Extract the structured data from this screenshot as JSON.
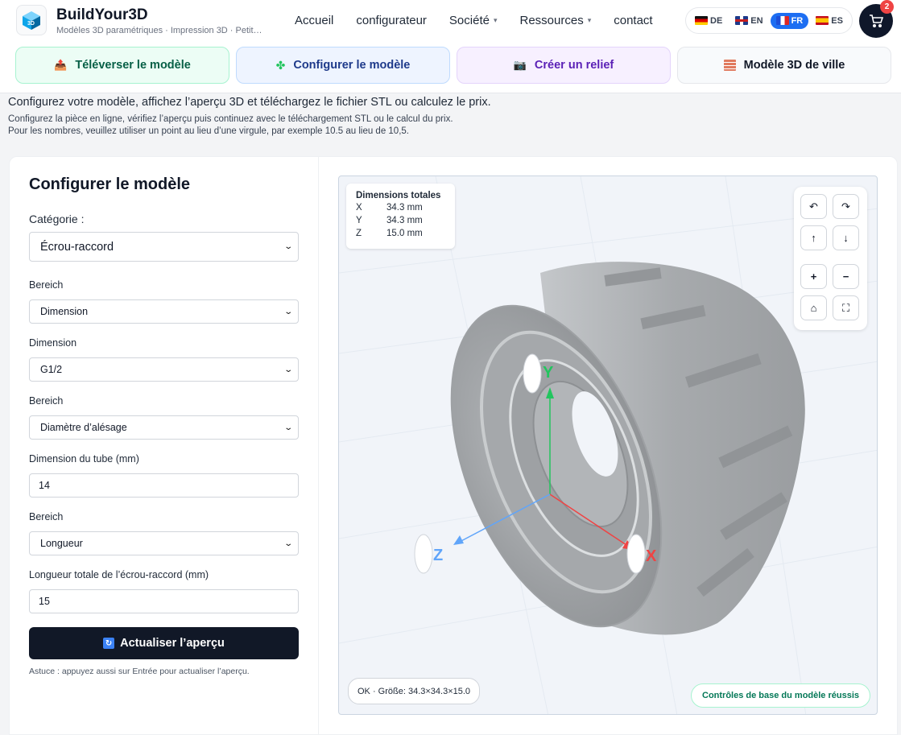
{
  "header": {
    "brand": "BuildYour3D",
    "tagline": "Modèles 3D paramétriques · Impression 3D · Petit…",
    "logo_icon": "cube-logo-icon",
    "nav": [
      {
        "label": "Accueil",
        "dropdown": false
      },
      {
        "label": "configurateur",
        "dropdown": false
      },
      {
        "label": "Société",
        "dropdown": true
      },
      {
        "label": "Ressources",
        "dropdown": true
      },
      {
        "label": "contact",
        "dropdown": false
      }
    ],
    "languages": [
      {
        "code": "DE",
        "active": false
      },
      {
        "code": "EN",
        "active": false
      },
      {
        "code": "FR",
        "active": true
      },
      {
        "code": "ES",
        "active": false
      }
    ],
    "cart_count": "2"
  },
  "tabs": [
    {
      "label": "Téléverser le modèle",
      "icon": "upload-box-icon"
    },
    {
      "label": "Configurer le modèle",
      "icon": "puzzle-icon"
    },
    {
      "label": "Créer un relief",
      "icon": "camera-icon"
    },
    {
      "label": "Modèle 3D de ville",
      "icon": "brick-icon"
    }
  ],
  "intro": {
    "line1": "Configurez votre modèle, affichez l’aperçu 3D et téléchargez le fichier STL ou calculez le prix.",
    "line2": "Configurez la pièce en ligne, vérifiez l’aperçu puis continuez avec le téléchargement STL ou le calcul du prix.",
    "line3": "Pour les nombres, veuillez utiliser un point au lieu d’une virgule, par exemple 10.5 au lieu de 10,5."
  },
  "form": {
    "title": "Configurer le modèle",
    "category_label": "Catégorie :",
    "category_value": "Écrou-raccord",
    "bereich1_label": "Bereich",
    "bereich1_value": "Dimension",
    "dimension_label": "Dimension",
    "dimension_value": "G1/2",
    "bereich2_label": "Bereich",
    "bereich2_value": "Diamètre d’alésage",
    "tube_label": "Dimension du tube (mm)",
    "tube_value": "14",
    "bereich3_label": "Bereich",
    "bereich3_value": "Longueur",
    "length_label": "Longueur totale de l’écrou-raccord (mm)",
    "length_value": "15",
    "update_button": "Actualiser l’aperçu",
    "hint": "Astuce : appuyez aussi sur Entrée pour actualiser l’aperçu."
  },
  "viewer": {
    "dims_title": "Dimensions totales",
    "dims": [
      {
        "axis": "X",
        "value": "34.3 mm"
      },
      {
        "axis": "Y",
        "value": "34.3 mm"
      },
      {
        "axis": "Z",
        "value": "15.0 mm"
      }
    ],
    "axis_labels": {
      "x": "X",
      "y": "Y",
      "z": "Z"
    },
    "status_left": "OK · Größe: 34.3×34.3×15.0",
    "status_right": "Contrôles de base du modèle réussis",
    "controls": {
      "rotate_left": "↶",
      "rotate_right": "↷",
      "move_up": "↑",
      "move_down": "↓",
      "zoom_in": "+",
      "zoom_out": "−",
      "home": "⌂",
      "fullscreen": "⛶"
    },
    "colors": {
      "x_axis": "#ef4444",
      "y_axis": "#22c55e",
      "z_axis": "#60a5fa",
      "model": "#a9acaf"
    }
  }
}
